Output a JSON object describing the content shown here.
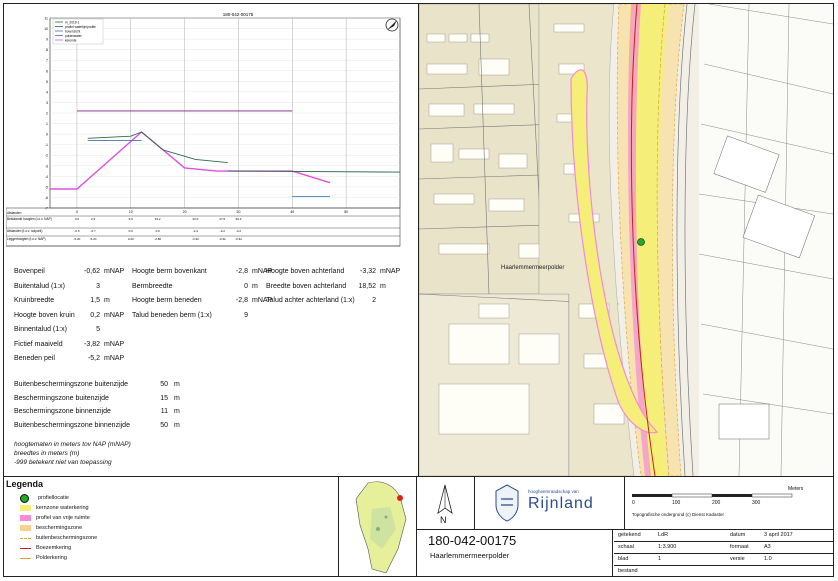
{
  "profile": {
    "title": "180-042-00175",
    "legend": [
      "m_2019-1",
      "profiel waterlijn/profile",
      "bovenzicht",
      "polderwater",
      "kerende"
    ],
    "y_ticks": [
      "11",
      "10",
      "9",
      "8",
      "7",
      "6",
      "5",
      "4",
      "3",
      "2",
      "1",
      "0",
      "-1",
      "-2",
      "-3",
      "-4",
      "-5",
      "-6",
      "-7"
    ],
    "x_ticks": [
      "0",
      "10",
      "20",
      "30",
      "40",
      "50"
    ],
    "table_rows": [
      {
        "label": "Afstanden",
        "values": []
      },
      {
        "label": "Bestaande hoogten (t.o.v. NAP)",
        "values": [
          "0.0",
          "2.9",
          "9.9",
          "15.2",
          "22.0",
          "27.5",
          "30.4"
        ]
      },
      {
        "label": "Afstanden (t.o.v. nulpunt)",
        "values": [
          "-0.5",
          "-0.7",
          "0.0",
          "0.0",
          "-2.4",
          "-3.2",
          "-3.2"
        ]
      },
      {
        "label": "Leggerhoogten (t.o.v. NAP)",
        "values": [
          "-5.20",
          "-5.20",
          "0.20",
          "-2.80",
          "-3.32",
          "-3.32",
          "-3.32"
        ]
      }
    ]
  },
  "chart_data": {
    "type": "line",
    "title": "180-042-00175",
    "xlabel": "",
    "ylabel": "",
    "xlim": [
      -5,
      60
    ],
    "ylim": [
      -7,
      11
    ],
    "series": [
      {
        "name": "profiel van vrije ruimte",
        "color": "#e050e0",
        "x": [
          -5,
          0,
          12,
          20,
          26,
          40,
          47
        ],
        "y": [
          -5.2,
          -5.2,
          0.2,
          -3.2,
          -3.5,
          -3.5,
          -4.6
        ]
      },
      {
        "name": "bovenzicht",
        "color": "#2e6b4e",
        "x": [
          2,
          10,
          12,
          16,
          22,
          28
        ],
        "y": [
          -0.4,
          -0.2,
          0.2,
          -1.5,
          -2.4,
          -2.7
        ]
      },
      {
        "name": "polderwater",
        "color": "#4a6fb0",
        "x": [
          2,
          12
        ],
        "y": [
          -0.6,
          -0.6
        ]
      },
      {
        "name": "kerende",
        "color": "#7a2080",
        "x": [
          0,
          40
        ],
        "y": [
          2.2,
          2.2
        ]
      },
      {
        "name": "polderwater",
        "color": "#3f7fc0",
        "x": [
          40,
          47
        ],
        "y": [
          -5.9,
          -5.9
        ]
      },
      {
        "name": "m_2019-1",
        "color": "#2e6b4e",
        "x": [
          28,
          60
        ],
        "y": [
          -3.5,
          -3.6
        ]
      }
    ]
  },
  "params": {
    "col1": [
      {
        "label": "Bovenpeil",
        "value": "-0,62",
        "unit": "mNAP"
      },
      {
        "label": "Buitentalud (1:x)",
        "value": "3",
        "unit": ""
      },
      {
        "label": "Kruinbreedte",
        "value": "1,5",
        "unit": "m"
      },
      {
        "label": "Hoogte boven kruin",
        "value": "0,2",
        "unit": "mNAP"
      },
      {
        "label": "Binnentalud (1:x)",
        "value": "5",
        "unit": ""
      },
      {
        "label": "Fictief maaiveld",
        "value": "-3,82",
        "unit": "mNAP"
      },
      {
        "label": "Beneden peil",
        "value": "-5,2",
        "unit": "mNAP"
      }
    ],
    "col2": [
      {
        "label": "Hoogte berm bovenkant",
        "value": "-2,8",
        "unit": "mNAP"
      },
      {
        "label": "Bermbreedte",
        "value": "0",
        "unit": "m"
      },
      {
        "label": "Hoogte berm beneden",
        "value": "-2,8",
        "unit": "mNAP"
      },
      {
        "label": "Talud beneden berm (1:x)",
        "value": "9",
        "unit": ""
      }
    ],
    "col3": [
      {
        "label": "Hoogte boven achterland",
        "value": "-3,32",
        "unit": "mNAP"
      },
      {
        "label": "Breedte boven achterland",
        "value": "18,52",
        "unit": "m"
      },
      {
        "label": "Talud achter achterland (1:x)",
        "value": "2",
        "unit": ""
      }
    ]
  },
  "zones": [
    {
      "label": "Buitenbeschermingszone buitenzijde",
      "value": "50",
      "unit": "m"
    },
    {
      "label": "Beschermingszone buitenzijde",
      "value": "15",
      "unit": "m"
    },
    {
      "label": "Beschermingszone binnenzijde",
      "value": "11",
      "unit": "m"
    },
    {
      "label": "Buitenbeschermingszone binnenzijde",
      "value": "50",
      "unit": "m"
    }
  ],
  "notes": [
    "hoogtematen in meters tov NAP (mNAP)",
    "breedtes in meters (m)",
    "-999 betekent niet van toepassing"
  ],
  "map": {
    "label": "Haarlemmermeerpolder"
  },
  "legend": {
    "title": "Legenda",
    "items": [
      {
        "label": "profiellocatie",
        "color": "#22aa22",
        "kind": "dot"
      },
      {
        "label": "kernzone waterkering",
        "color": "#f5ef7a",
        "kind": "fill"
      },
      {
        "label": "profiel van vrije ruimte",
        "color": "#f58ad8",
        "kind": "fill"
      },
      {
        "label": "beschermingszone",
        "color": "#f7d28a",
        "kind": "fill"
      },
      {
        "label": "buitenbeschermingszone",
        "color": "#e3a63a",
        "kind": "dash"
      },
      {
        "label": "Boezemkering",
        "color": "#cc1f1f",
        "kind": "line"
      },
      {
        "label": "Polderkering",
        "color": "#d4a33a",
        "kind": "line"
      }
    ]
  },
  "north": "N",
  "logo": {
    "subtitle": "hoogheemraadschap van",
    "name": "Rijnland"
  },
  "scale": {
    "labels": [
      "0",
      "100",
      "200",
      "300"
    ],
    "unit": "Meters",
    "source": "Topografische ondergrond (c) Dienst Kadaster"
  },
  "footer": {
    "id": "180-042-00175",
    "name": "Haarlemmermeerpolder"
  },
  "meta": [
    {
      "label": "getekend",
      "value": "LdR",
      "label2": "datum",
      "value2": "3 april 2017"
    },
    {
      "label": "schaal",
      "value": "1:3.900",
      "label2": "formaat",
      "value2": "A3"
    },
    {
      "label": "blad",
      "value": "1",
      "label2": "versie",
      "value2": "1.0"
    },
    {
      "label": "bestand",
      "value": "",
      "label2": "",
      "value2": ""
    }
  ]
}
